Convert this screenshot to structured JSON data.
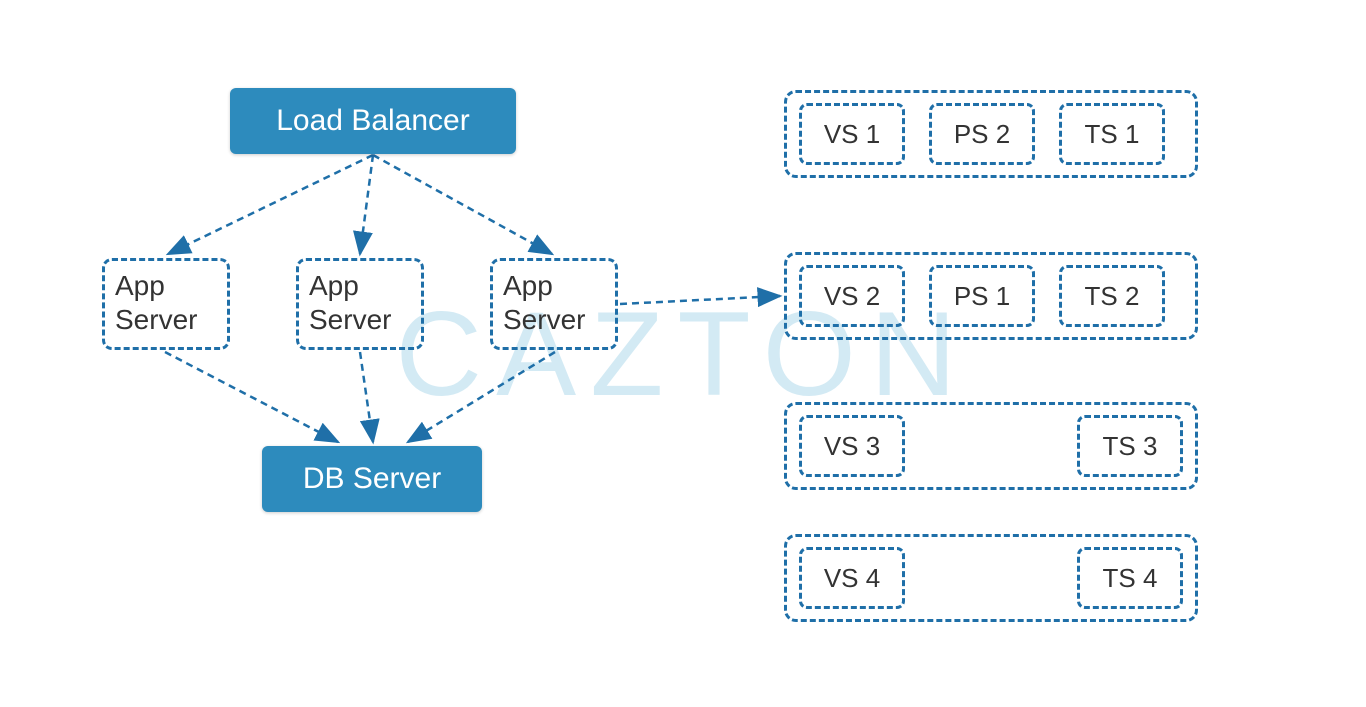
{
  "watermark": "CAZTON",
  "load_balancer": "Load Balancer",
  "app_server_1": "App Server",
  "app_server_2": "App Server",
  "app_server_3": "App Server",
  "db_server": "DB Server",
  "rows": [
    {
      "cells": [
        "VS 1",
        "PS 2",
        "TS 1"
      ]
    },
    {
      "cells": [
        "VS 2",
        "PS 1",
        "TS 2"
      ]
    },
    {
      "cells": [
        "VS 3",
        "TS 3"
      ]
    },
    {
      "cells": [
        "VS 4",
        "TS 4"
      ]
    }
  ],
  "colors": {
    "solid": "#2d8bbd",
    "dash": "#1f6fa8"
  }
}
